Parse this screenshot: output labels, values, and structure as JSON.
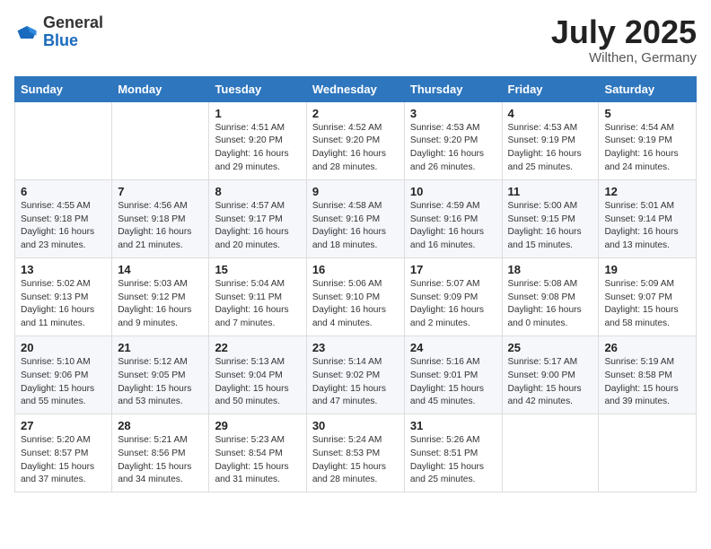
{
  "logo": {
    "general": "General",
    "blue": "Blue"
  },
  "title": {
    "month": "July 2025",
    "location": "Wilthen, Germany"
  },
  "weekdays": [
    "Sunday",
    "Monday",
    "Tuesday",
    "Wednesday",
    "Thursday",
    "Friday",
    "Saturday"
  ],
  "weeks": [
    [
      {
        "day": "",
        "content": ""
      },
      {
        "day": "",
        "content": ""
      },
      {
        "day": "1",
        "content": "Sunrise: 4:51 AM\nSunset: 9:20 PM\nDaylight: 16 hours and 29 minutes."
      },
      {
        "day": "2",
        "content": "Sunrise: 4:52 AM\nSunset: 9:20 PM\nDaylight: 16 hours and 28 minutes."
      },
      {
        "day": "3",
        "content": "Sunrise: 4:53 AM\nSunset: 9:20 PM\nDaylight: 16 hours and 26 minutes."
      },
      {
        "day": "4",
        "content": "Sunrise: 4:53 AM\nSunset: 9:19 PM\nDaylight: 16 hours and 25 minutes."
      },
      {
        "day": "5",
        "content": "Sunrise: 4:54 AM\nSunset: 9:19 PM\nDaylight: 16 hours and 24 minutes."
      }
    ],
    [
      {
        "day": "6",
        "content": "Sunrise: 4:55 AM\nSunset: 9:18 PM\nDaylight: 16 hours and 23 minutes."
      },
      {
        "day": "7",
        "content": "Sunrise: 4:56 AM\nSunset: 9:18 PM\nDaylight: 16 hours and 21 minutes."
      },
      {
        "day": "8",
        "content": "Sunrise: 4:57 AM\nSunset: 9:17 PM\nDaylight: 16 hours and 20 minutes."
      },
      {
        "day": "9",
        "content": "Sunrise: 4:58 AM\nSunset: 9:16 PM\nDaylight: 16 hours and 18 minutes."
      },
      {
        "day": "10",
        "content": "Sunrise: 4:59 AM\nSunset: 9:16 PM\nDaylight: 16 hours and 16 minutes."
      },
      {
        "day": "11",
        "content": "Sunrise: 5:00 AM\nSunset: 9:15 PM\nDaylight: 16 hours and 15 minutes."
      },
      {
        "day": "12",
        "content": "Sunrise: 5:01 AM\nSunset: 9:14 PM\nDaylight: 16 hours and 13 minutes."
      }
    ],
    [
      {
        "day": "13",
        "content": "Sunrise: 5:02 AM\nSunset: 9:13 PM\nDaylight: 16 hours and 11 minutes."
      },
      {
        "day": "14",
        "content": "Sunrise: 5:03 AM\nSunset: 9:12 PM\nDaylight: 16 hours and 9 minutes."
      },
      {
        "day": "15",
        "content": "Sunrise: 5:04 AM\nSunset: 9:11 PM\nDaylight: 16 hours and 7 minutes."
      },
      {
        "day": "16",
        "content": "Sunrise: 5:06 AM\nSunset: 9:10 PM\nDaylight: 16 hours and 4 minutes."
      },
      {
        "day": "17",
        "content": "Sunrise: 5:07 AM\nSunset: 9:09 PM\nDaylight: 16 hours and 2 minutes."
      },
      {
        "day": "18",
        "content": "Sunrise: 5:08 AM\nSunset: 9:08 PM\nDaylight: 16 hours and 0 minutes."
      },
      {
        "day": "19",
        "content": "Sunrise: 5:09 AM\nSunset: 9:07 PM\nDaylight: 15 hours and 58 minutes."
      }
    ],
    [
      {
        "day": "20",
        "content": "Sunrise: 5:10 AM\nSunset: 9:06 PM\nDaylight: 15 hours and 55 minutes."
      },
      {
        "day": "21",
        "content": "Sunrise: 5:12 AM\nSunset: 9:05 PM\nDaylight: 15 hours and 53 minutes."
      },
      {
        "day": "22",
        "content": "Sunrise: 5:13 AM\nSunset: 9:04 PM\nDaylight: 15 hours and 50 minutes."
      },
      {
        "day": "23",
        "content": "Sunrise: 5:14 AM\nSunset: 9:02 PM\nDaylight: 15 hours and 47 minutes."
      },
      {
        "day": "24",
        "content": "Sunrise: 5:16 AM\nSunset: 9:01 PM\nDaylight: 15 hours and 45 minutes."
      },
      {
        "day": "25",
        "content": "Sunrise: 5:17 AM\nSunset: 9:00 PM\nDaylight: 15 hours and 42 minutes."
      },
      {
        "day": "26",
        "content": "Sunrise: 5:19 AM\nSunset: 8:58 PM\nDaylight: 15 hours and 39 minutes."
      }
    ],
    [
      {
        "day": "27",
        "content": "Sunrise: 5:20 AM\nSunset: 8:57 PM\nDaylight: 15 hours and 37 minutes."
      },
      {
        "day": "28",
        "content": "Sunrise: 5:21 AM\nSunset: 8:56 PM\nDaylight: 15 hours and 34 minutes."
      },
      {
        "day": "29",
        "content": "Sunrise: 5:23 AM\nSunset: 8:54 PM\nDaylight: 15 hours and 31 minutes."
      },
      {
        "day": "30",
        "content": "Sunrise: 5:24 AM\nSunset: 8:53 PM\nDaylight: 15 hours and 28 minutes."
      },
      {
        "day": "31",
        "content": "Sunrise: 5:26 AM\nSunset: 8:51 PM\nDaylight: 15 hours and 25 minutes."
      },
      {
        "day": "",
        "content": ""
      },
      {
        "day": "",
        "content": ""
      }
    ]
  ]
}
